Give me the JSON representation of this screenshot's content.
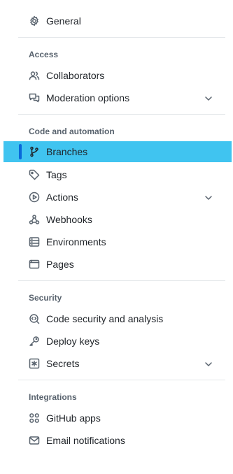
{
  "nav": {
    "general": {
      "label": "General",
      "icon": "gear-icon"
    },
    "access": {
      "heading": "Access",
      "items": [
        {
          "label": "Collaborators",
          "icon": "people-icon"
        },
        {
          "label": "Moderation options",
          "icon": "comment-discussion-icon",
          "expandable": true
        }
      ]
    },
    "code_automation": {
      "heading": "Code and automation",
      "items": [
        {
          "label": "Branches",
          "icon": "git-branch-icon",
          "active": true
        },
        {
          "label": "Tags",
          "icon": "tag-icon"
        },
        {
          "label": "Actions",
          "icon": "play-icon",
          "expandable": true
        },
        {
          "label": "Webhooks",
          "icon": "webhook-icon"
        },
        {
          "label": "Environments",
          "icon": "server-icon"
        },
        {
          "label": "Pages",
          "icon": "browser-icon"
        }
      ]
    },
    "security": {
      "heading": "Security",
      "items": [
        {
          "label": "Code security and analysis",
          "icon": "codescan-icon"
        },
        {
          "label": "Deploy keys",
          "icon": "key-icon"
        },
        {
          "label": "Secrets",
          "icon": "key-asterisk-icon",
          "expandable": true
        }
      ]
    },
    "integrations": {
      "heading": "Integrations",
      "items": [
        {
          "label": "GitHub apps",
          "icon": "apps-icon"
        },
        {
          "label": "Email notifications",
          "icon": "mail-icon"
        }
      ]
    }
  },
  "colors": {
    "active_background": "#40c4f0",
    "active_indicator": "#0969da",
    "heading_text": "#59636e",
    "divider": "#e4e7ea"
  }
}
